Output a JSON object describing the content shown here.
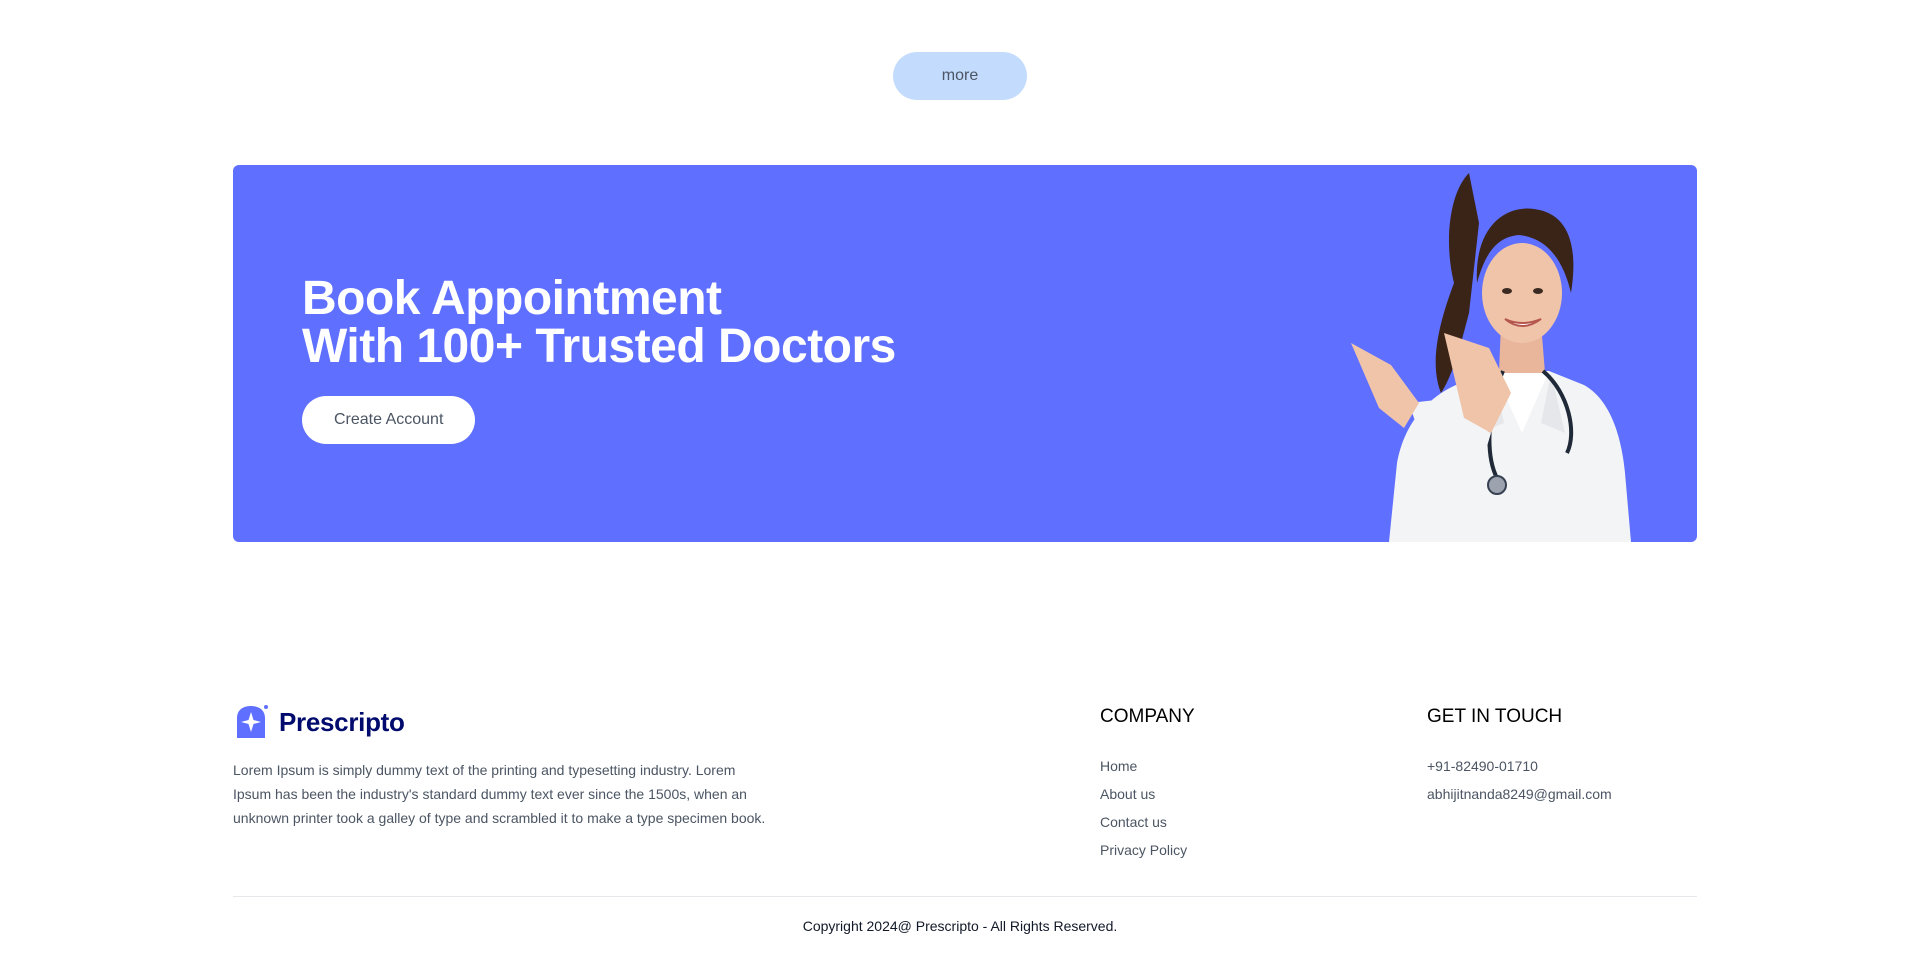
{
  "more_button": {
    "label": "more"
  },
  "banner": {
    "line1": "Book Appointment",
    "line2": "With 100+ Trusted Doctors",
    "cta_label": "Create Account",
    "background_color": "#5f6fff"
  },
  "footer": {
    "brand": {
      "name": "Prescripto",
      "icon": "prescripto-logo-icon",
      "color": "#000b6d"
    },
    "about": "Lorem Ipsum is simply dummy text of the printing and typesetting industry. Lorem Ipsum has been the industry's standard dummy text ever since the 1500s, when an unknown printer took a galley of type and scrambled it to make a type specimen book.",
    "company": {
      "heading": "COMPANY",
      "links": [
        "Home",
        "About us",
        "Contact us",
        "Privacy Policy"
      ]
    },
    "contact": {
      "heading": "GET IN TOUCH",
      "phone": "+91-82490-01710",
      "email": "abhijitnanda8249@gmail.com"
    },
    "copyright": "Copyright 2024@ Prescripto - All Rights Reserved."
  },
  "colors": {
    "accent": "#5f6fff",
    "more_button_bg": "#c3dcfd",
    "brand_text": "#000b6d"
  }
}
